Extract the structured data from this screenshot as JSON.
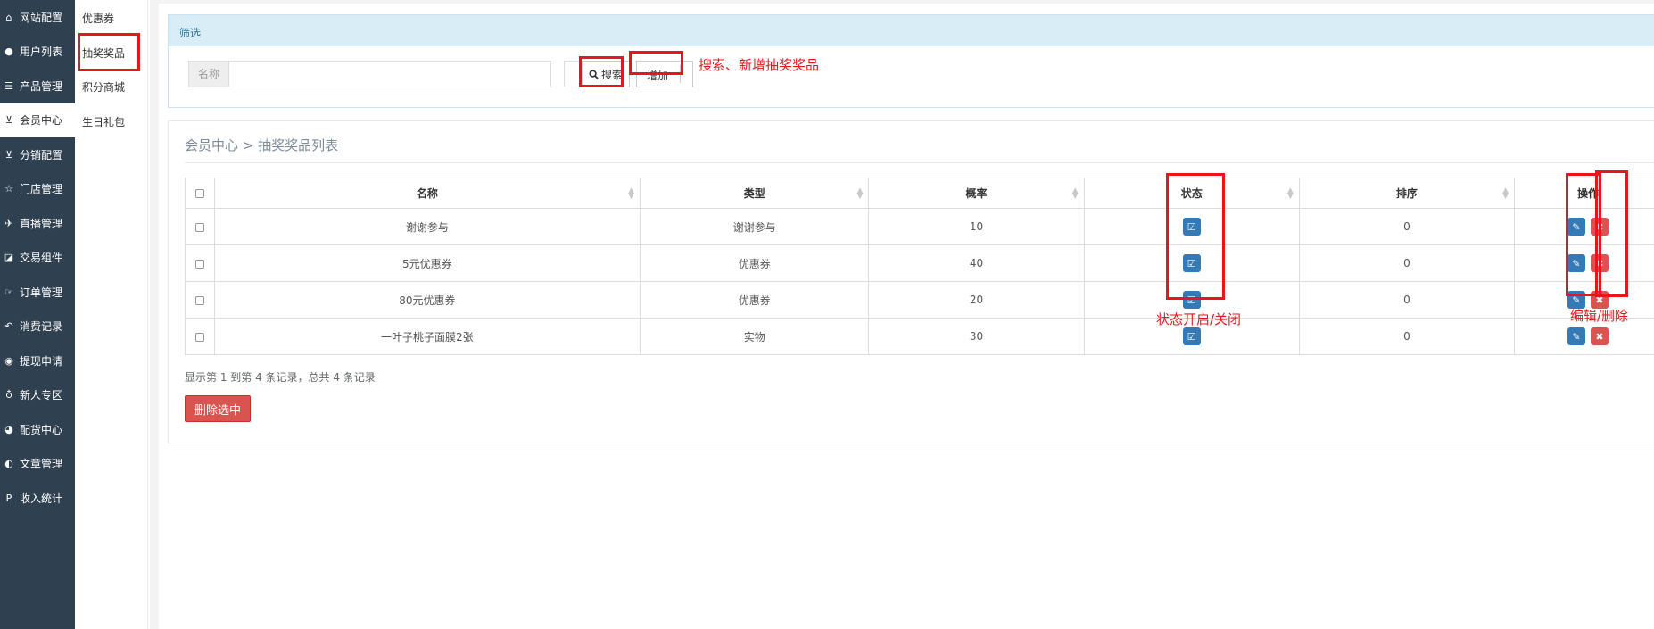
{
  "sidebar": {
    "items": [
      {
        "label": "网站配置",
        "icon": "home-icon",
        "glyph": "⌂",
        "active": false
      },
      {
        "label": "用户列表",
        "icon": "user-icon",
        "glyph": "●",
        "active": false
      },
      {
        "label": "产品管理",
        "icon": "list-icon",
        "glyph": "☰",
        "active": false
      },
      {
        "label": "会员中心",
        "icon": "cart-icon",
        "glyph": "⊻",
        "active": true
      },
      {
        "label": "分销配置",
        "icon": "cart-icon",
        "glyph": "⊻",
        "active": false
      },
      {
        "label": "门店管理",
        "icon": "star-icon",
        "glyph": "☆",
        "active": false
      },
      {
        "label": "直播管理",
        "icon": "plane-icon",
        "glyph": "✈",
        "active": false
      },
      {
        "label": "交易组件",
        "icon": "eraser-icon",
        "glyph": "◪",
        "active": false
      },
      {
        "label": "订单管理",
        "icon": "hand-icon",
        "glyph": "☞",
        "active": false
      },
      {
        "label": "消费记录",
        "icon": "reply-icon",
        "glyph": "↶",
        "active": false
      },
      {
        "label": "提现申请",
        "icon": "wechat-icon",
        "glyph": "◉",
        "active": false
      },
      {
        "label": "新人专区",
        "icon": "map-marker-icon",
        "glyph": "♁",
        "active": false
      },
      {
        "label": "配货中心",
        "icon": "pie-chart-icon",
        "glyph": "◕",
        "active": false
      },
      {
        "label": "文章管理",
        "icon": "adjust-icon",
        "glyph": "◐",
        "active": false
      },
      {
        "label": "收入统计",
        "icon": "paypal-icon",
        "glyph": "P",
        "active": false
      }
    ]
  },
  "submenu": {
    "items": [
      {
        "label": "优惠券"
      },
      {
        "label": "抽奖奖品"
      },
      {
        "label": "积分商城"
      },
      {
        "label": "生日礼包"
      }
    ]
  },
  "filter": {
    "title": "筛选",
    "name_addon": "名称",
    "name_value": "",
    "search_label": "搜索",
    "add_label": "增加"
  },
  "annotations": {
    "search_note": "搜索、新增抽奖奖品",
    "status_note": "状态开启/关闭",
    "ops_note": "编辑/删除"
  },
  "list": {
    "breadcrumb": "会员中心 > 抽奖奖品列表",
    "columns": [
      "名称",
      "类型",
      "概率",
      "状态",
      "排序",
      "操作"
    ],
    "rows": [
      {
        "name": "谢谢参与",
        "type": "谢谢参与",
        "prob": "10",
        "sort": "0"
      },
      {
        "name": "5元优惠券",
        "type": "优惠券",
        "prob": "40",
        "sort": "0"
      },
      {
        "name": "80元优惠券",
        "type": "优惠券",
        "prob": "20",
        "sort": "0"
      },
      {
        "name": "一叶子桃子面膜2张",
        "type": "实物",
        "prob": "30",
        "sort": "0"
      }
    ],
    "footer": "显示第 1 到第 4 条记录，总共 4 条记录",
    "delete_selected": "删除选中"
  },
  "colors": {
    "sidebar_bg": "#2f4050",
    "highlight": "#e8161c",
    "primary": "#337ab7",
    "danger": "#d9534f"
  }
}
